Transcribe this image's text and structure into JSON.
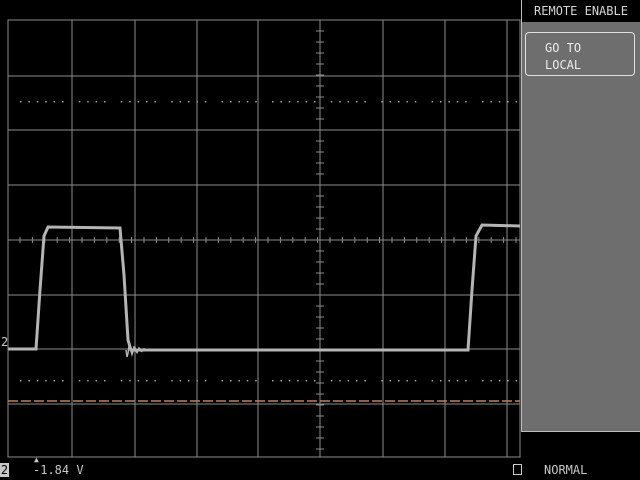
{
  "menu": {
    "title": "REMOTE ENABLE",
    "softkey_line1": "GO TO",
    "softkey_line2": "LOCAL"
  },
  "channel_marker": "2",
  "status": {
    "channel": "2",
    "trigger_level": "-1.84 V",
    "mode": "NORMAL"
  },
  "colors": {
    "background": "#000000",
    "graticule": "#9a9a9a",
    "trace": "#b4b4b4",
    "cursor_line": "#c08060",
    "menu_panel": "#6e6e6e"
  },
  "icons": {
    "trigger_marker": "triangle-up-icon",
    "acquisition_state": "square-icon"
  }
}
